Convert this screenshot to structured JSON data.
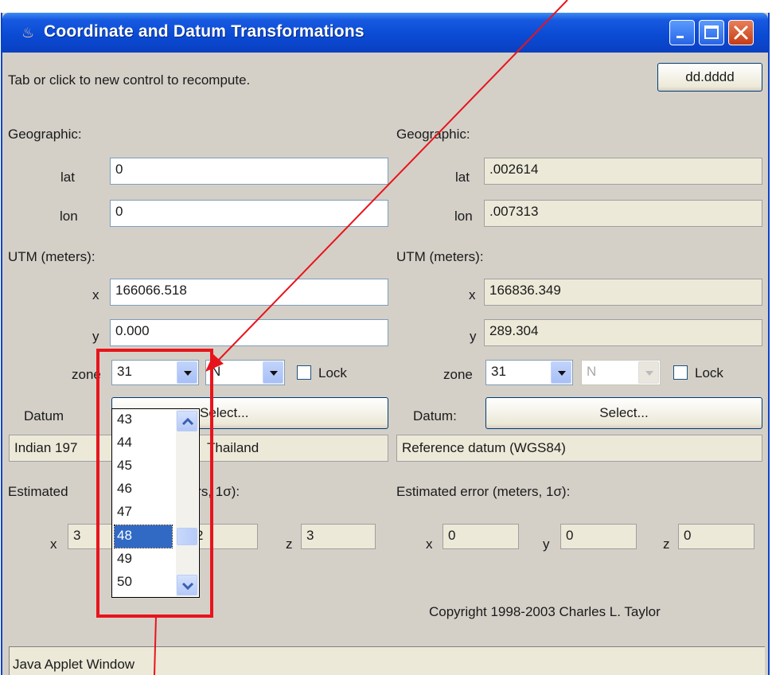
{
  "window": {
    "title": "Coordinate and Datum Transformations",
    "icon": "java-cup-icon",
    "controls": [
      "minimize-icon",
      "maximize-icon",
      "close-icon"
    ]
  },
  "hint": "Tab or click to new control to recompute.",
  "format_button": "dd.dddd",
  "left": {
    "geographic_label": "Geographic:",
    "lat_label": "lat",
    "lat_value": "0",
    "lon_label": "lon",
    "lon_value": "0",
    "utm_label": "UTM (meters):",
    "x_label": "x",
    "x_value": "166066.518",
    "y_label": "y",
    "y_value": "0.000",
    "zone_label": "zone",
    "zone_value": "31",
    "hemisphere_value": "N",
    "lock_label": "Lock",
    "datum_label": "Datum:",
    "datum_label_visible": "Datum",
    "select_button": "Select...",
    "datum_name_start": "Indian 197",
    "datum_name_end": "Thailand",
    "error_label_start": "Estimated",
    "error_label_end": "ters, 1σ):",
    "err_x_label": "x",
    "err_x_value": "3",
    "err_y_value": "2",
    "err_z_label": "z",
    "err_z_value": "3"
  },
  "right": {
    "geographic_label": "Geographic:",
    "lat_label": "lat",
    "lat_value": ".002614",
    "lon_label": "lon",
    "lon_value": ".007313",
    "utm_label": "UTM (meters):",
    "x_label": "x",
    "x_value": "166836.349",
    "y_label": "y",
    "y_value": "289.304",
    "zone_label": "zone",
    "zone_value": "31",
    "hemisphere_value": "N",
    "lock_label": "Lock",
    "datum_label": "Datum:",
    "select_button": "Select...",
    "datum_name": "Reference datum (WGS84)",
    "error_label": "Estimated error (meters, 1σ):",
    "err_x_label": "x",
    "err_x_value": "0",
    "err_y_label": "y",
    "err_y_value": "0",
    "err_z_label": "z",
    "err_z_value": "0"
  },
  "zone_dropdown": {
    "items": [
      "43",
      "44",
      "45",
      "46",
      "47",
      "48",
      "49",
      "50"
    ],
    "selected": "48"
  },
  "copyright": "Copyright 1998-2003 Charles L. Taylor",
  "status": "Java Applet Window",
  "annotation": {
    "color": "#e8141c"
  }
}
